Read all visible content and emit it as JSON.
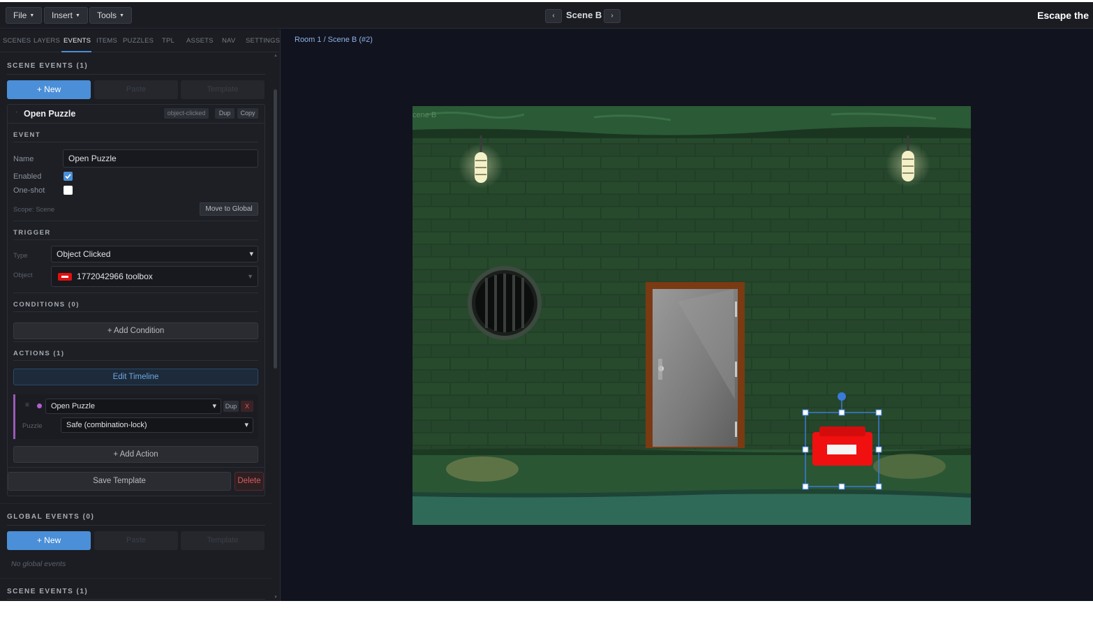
{
  "topbar": {
    "menus": [
      {
        "label": "File"
      },
      {
        "label": "Insert"
      },
      {
        "label": "Tools"
      }
    ],
    "prev_symbol": "‹",
    "next_symbol": "›",
    "scene_title": "Scene B",
    "app_title": "Escape the"
  },
  "tabs": [
    "SCENES",
    "LAYERS",
    "EVENTS",
    "ITEMS",
    "PUZZLES",
    "TPL",
    "ASSETS",
    "NAV",
    "SETTINGS"
  ],
  "active_tab": "EVENTS",
  "scene_events": {
    "heading": "SCENE EVENTS (1)",
    "new_label": "+ New",
    "paste_label": "Paste",
    "template_label": "Template",
    "event": {
      "collapse_symbol": "·",
      "title": "Open Puzzle",
      "trigger_badge": "object-clicked",
      "dup_label": "Dup",
      "copy_label": "Copy",
      "event_heading": "EVENT",
      "name_label": "Name",
      "name_value": "Open Puzzle",
      "enabled_label": "Enabled",
      "enabled": true,
      "oneshot_label": "One-shot",
      "oneshot": false,
      "scope_text": "Scope: Scene",
      "move_global_label": "Move to Global",
      "trigger_heading": "TRIGGER",
      "type_label": "Type",
      "type_value": "Object Clicked",
      "object_label": "Object",
      "object_value": "1772042966 toolbox",
      "conditions_heading": "CONDITIONS (0)",
      "add_condition_label": "+ Add Condition",
      "actions_heading": "ACTIONS (1)",
      "edit_timeline_label": "Edit Timeline",
      "action": {
        "handle_symbol": "≡",
        "type_value": "Open Puzzle",
        "dup_label": "Dup",
        "remove_label": "X",
        "puzzle_label": "Puzzle",
        "puzzle_value": "Safe (combination-lock)"
      },
      "add_action_label": "+ Add Action",
      "save_template_label": "Save Template",
      "delete_label": "Delete"
    }
  },
  "global_events": {
    "heading": "GLOBAL EVENTS (0)",
    "new_label": "+ New",
    "paste_label": "Paste",
    "template_label": "Template",
    "empty_text": "No global events"
  },
  "scene_events_footer": "SCENE EVENTS (1)",
  "canvas": {
    "breadcrumb": "Room 1 / Scene B (#2)",
    "scene_watermark": "cene B"
  },
  "colors": {
    "accent": "#4a90d9",
    "danger": "#e05a5a",
    "action_stripe": "#9b59b6",
    "selection": "#3a7ad9"
  }
}
